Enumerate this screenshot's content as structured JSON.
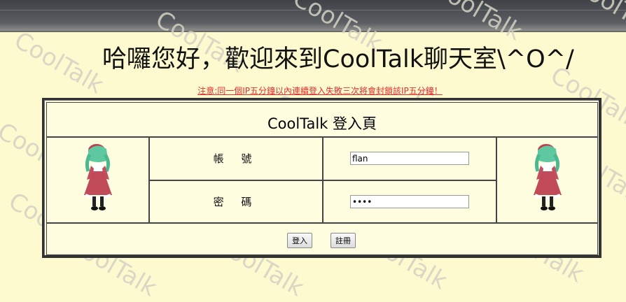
{
  "watermark": "CoolTalk",
  "page_title": "哈囉您好，歡迎來到CoolTalk聊天室\\^O^/",
  "notice": "注意:同一個IP五分鐘以內連續登入失敗三次將會封鎖該IP五分鐘！",
  "login": {
    "header": "CoolTalk 登入頁",
    "account_label": "帳  號",
    "account_value": "flan",
    "password_label": "密  碼",
    "password_value": "flan"
  },
  "buttons": {
    "login": "登入",
    "register": "註冊"
  },
  "colors": {
    "background": "#fefad0",
    "notice": "#e03030",
    "frame_border": "#333333"
  }
}
